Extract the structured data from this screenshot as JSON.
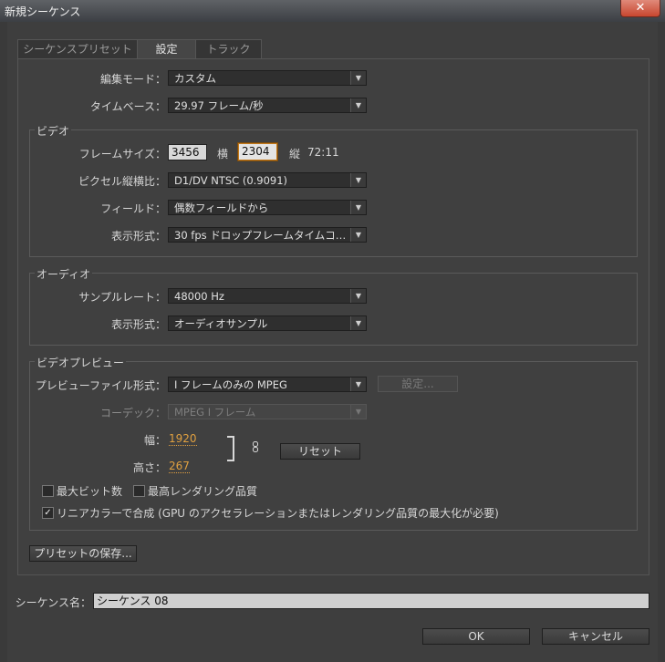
{
  "window": {
    "title": "新規シーケンス",
    "close_label": "✕"
  },
  "tabs": [
    {
      "label": "シーケンスプリセット",
      "active": false
    },
    {
      "label": "設定",
      "active": true
    },
    {
      "label": "トラック",
      "active": false
    }
  ],
  "general": {
    "edit_mode_label": "編集モード：",
    "edit_mode_value": "カスタム",
    "timebase_label": "タイムベース：",
    "timebase_value": "29.97 フレーム/秒"
  },
  "video": {
    "group_title": "ビデオ",
    "frame_size_label": "フレームサイズ：",
    "width_value": "3456",
    "width_unit": "横",
    "height_value": "2304",
    "height_unit": "縦",
    "aspect": "72:11",
    "pixel_aspect_label": "ピクセル縦横比：",
    "pixel_aspect_value": "D1/DV NTSC (0.9091)",
    "field_label": "フィールド：",
    "field_value": "偶数フィールドから",
    "display_label": "表示形式：",
    "display_value": "30 fps ドロップフレームタイムコ…"
  },
  "audio": {
    "group_title": "オーディオ",
    "sample_rate_label": "サンプルレート：",
    "sample_rate_value": "48000 Hz",
    "display_label": "表示形式：",
    "display_value": "オーディオサンプル"
  },
  "preview": {
    "group_title": "ビデオプレビュー",
    "file_format_label": "プレビューファイル形式：",
    "file_format_value": "I フレームのみの MPEG",
    "settings_button": "設定...",
    "codec_label": "コーデック：",
    "codec_value": "MPEG I フレーム",
    "width_label": "幅：",
    "width_value": "1920",
    "height_label": "高さ：",
    "height_value": "267",
    "reset_button": "リセット",
    "max_bit_depth_label": "最大ビット数",
    "max_bit_depth_checked": false,
    "max_render_quality_label": "最高レンダリング品質",
    "max_render_quality_checked": false,
    "linear_color_label": "リニアカラーで合成 (GPU のアクセラレーションまたはレンダリング品質の最大化が必要)",
    "linear_color_checked": true
  },
  "save_preset_button": "プリセットの保存...",
  "sequence_name_label": "シーケンス名：",
  "sequence_name_value": "シーケンス 08",
  "ok_button": "OK",
  "cancel_button": "キャンセル",
  "colors": {
    "accent": "#e0a040",
    "focus": "#c47a1a",
    "close": "#c8462f"
  }
}
